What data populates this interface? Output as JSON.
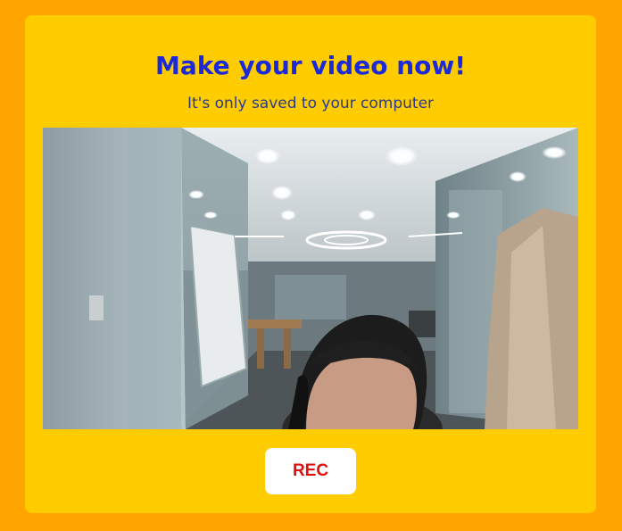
{
  "header": {
    "title": "Make your video now!",
    "subtitle": "It's only saved to your computer"
  },
  "video": {
    "content": "webcam-preview"
  },
  "controls": {
    "rec_label": "REC"
  },
  "colors": {
    "page_background": "#FFA500",
    "card_background": "#FFCC00",
    "title_color": "#1A2AD9",
    "rec_text_color": "#E01010"
  }
}
